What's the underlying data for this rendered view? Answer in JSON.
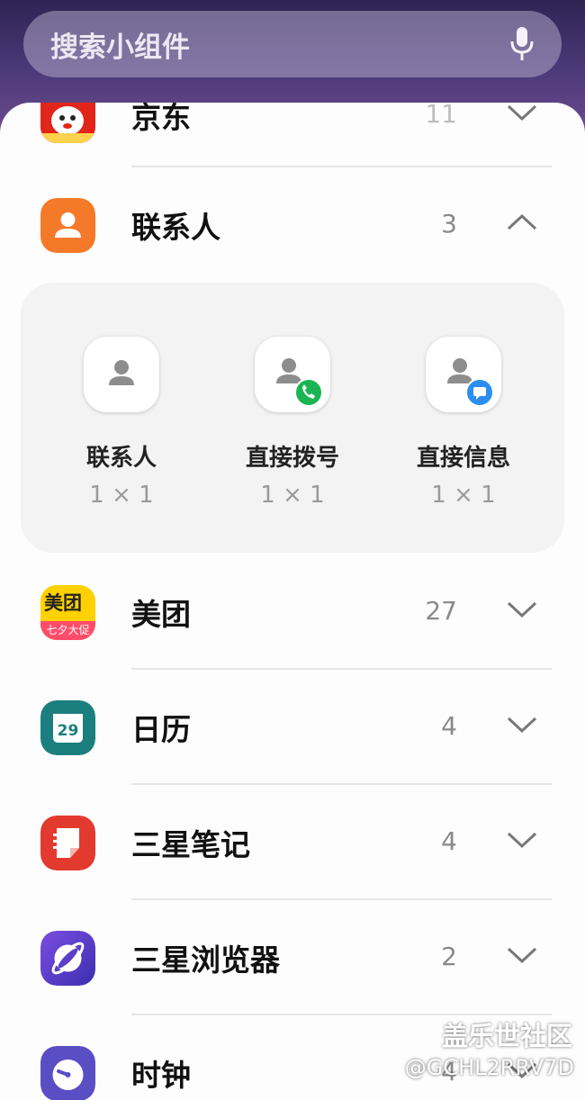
{
  "search": {
    "placeholder": "搜索小组件"
  },
  "apps": [
    {
      "name": "京东",
      "count": "11",
      "icon": "jd-app-icon",
      "expanded": false
    },
    {
      "name": "联系人",
      "count": "3",
      "icon": "contacts-app-icon",
      "expanded": true
    },
    {
      "name": "美团",
      "count": "27",
      "icon": "meituan-app-icon",
      "expanded": false
    },
    {
      "name": "日历",
      "count": "4",
      "icon": "calendar-app-icon",
      "expanded": false,
      "icon_text": "29"
    },
    {
      "name": "三星笔记",
      "count": "4",
      "icon": "samsung-notes-app-icon",
      "expanded": false
    },
    {
      "name": "三星浏览器",
      "count": "2",
      "icon": "samsung-browser-app-icon",
      "expanded": false
    },
    {
      "name": "时钟",
      "count": "4",
      "icon": "clock-app-icon",
      "expanded": false
    }
  ],
  "meituan_icon": {
    "line1": "美团",
    "line2": "七夕大促"
  },
  "contacts_widgets": [
    {
      "label": "联系人",
      "size": "1 × 1"
    },
    {
      "label": "直接拨号",
      "size": "1 × 1"
    },
    {
      "label": "直接信息",
      "size": "1 × 1"
    }
  ],
  "watermark": {
    "line1": "盖乐世社区",
    "line2": "@GCHL2RRV7D"
  },
  "colors": {
    "contacts": "#f47a2a",
    "calendar": "#1a7f7e",
    "notes": "#e23a2e",
    "browser": "#5d3ec8",
    "clock": "#5a4ec4",
    "meituan": "#ffd100",
    "dial_badge": "#1ab552",
    "msg_badge": "#2b8ef0"
  }
}
